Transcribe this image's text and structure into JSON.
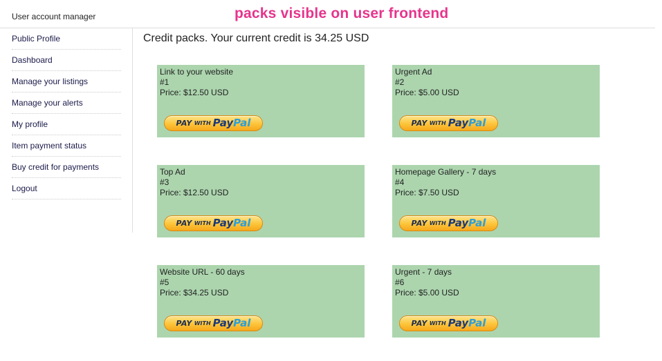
{
  "header": {
    "title": "User account manager",
    "annotation": "packs visible on user frontend"
  },
  "sidebar": {
    "items": [
      {
        "label": "Public Profile"
      },
      {
        "label": "Dashboard"
      },
      {
        "label": "Manage your listings"
      },
      {
        "label": "Manage your alerts"
      },
      {
        "label": "My profile"
      },
      {
        "label": "Item payment status"
      },
      {
        "label": "Buy credit for payments"
      },
      {
        "label": "Logout"
      }
    ]
  },
  "main": {
    "title": "Credit packs. Your current credit is 34.25 USD",
    "packs": [
      {
        "name": "Link to your website",
        "id": "#1",
        "price": "Price: $12.50 USD"
      },
      {
        "name": "Urgent Ad",
        "id": "#2",
        "price": "Price: $5.00 USD"
      },
      {
        "name": "Top Ad",
        "id": "#3",
        "price": "Price: $12.50 USD"
      },
      {
        "name": "Homepage Gallery - 7 days",
        "id": "#4",
        "price": "Price: $7.50 USD"
      },
      {
        "name": "Website URL - 60 days",
        "id": "#5",
        "price": "Price: $34.25 USD"
      },
      {
        "name": "Urgent - 7 days",
        "id": "#6",
        "price": "Price: $5.00 USD"
      }
    ],
    "paypal_button": {
      "pay": "PAY",
      "with": "WITH",
      "brand_pay": "Pay",
      "brand_pal": "Pal"
    }
  },
  "colors": {
    "pack_background": "#acd5ae",
    "annotation": "#e6348c",
    "paypal_gold": "#fcc43a",
    "paypal_dark_blue": "#1b3a7a",
    "paypal_light_blue": "#2e9ed8"
  }
}
